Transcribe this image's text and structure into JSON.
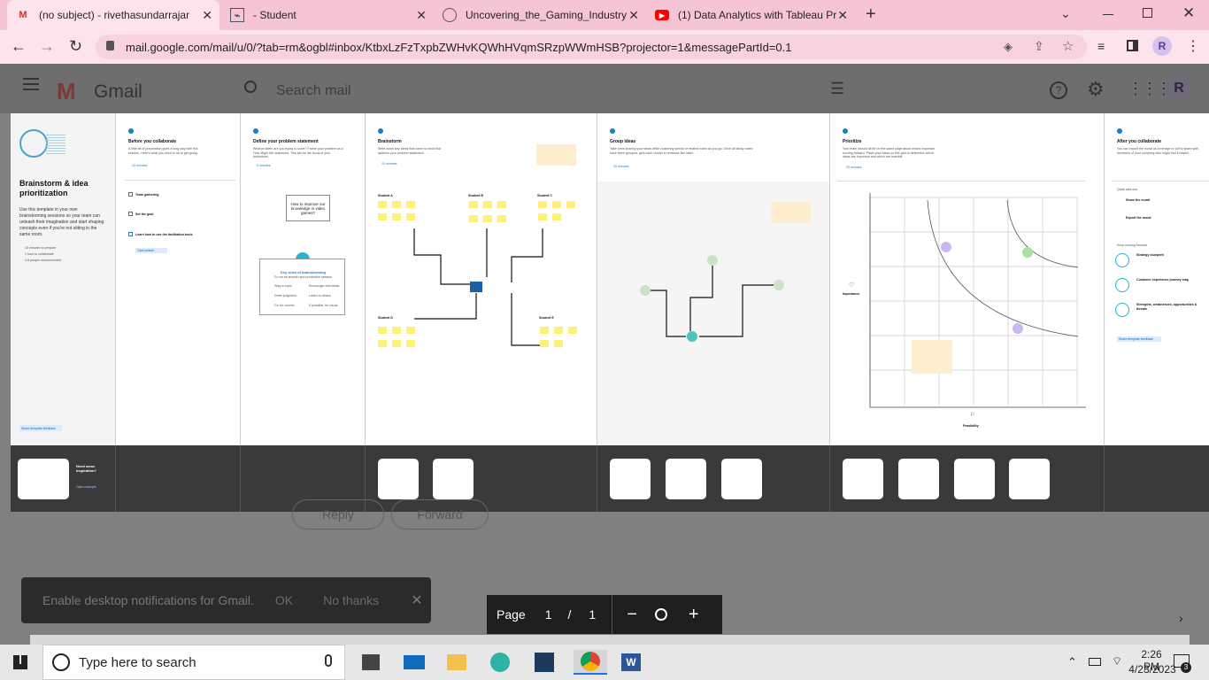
{
  "browser": {
    "tabs": [
      {
        "title": "(no subject) - rivethasundarrajan",
        "icon": "gmail-icon"
      },
      {
        "title": "- Student",
        "icon": "student-icon"
      },
      {
        "title": "Uncovering_the_Gaming_Industry",
        "icon": "globe-icon"
      },
      {
        "title": "(1) Data Analytics with Tableau Pr",
        "icon": "youtube-icon"
      }
    ],
    "new_tab_label": "+",
    "url": "mail.google.com/mail/u/0/?tab=rm&ogbl#inbox/KtbxLzFzTxpbZWHvKQWhHVqmSRzpWWmHSB?projector=1&messagePartId=0.1"
  },
  "gmail": {
    "logo_text": "Gmail",
    "search_placeholder": "Search mail"
  },
  "document": {
    "intro": {
      "title": "Brainstorm & idea prioritization",
      "body": "Use this template in your own brainstorming sessions so your team can unleash their imagination and start shaping concepts even if you're not sitting in the same room.",
      "meta": [
        "10 minutes to prepare",
        "1 hour to collaborate",
        "2-8 people recommended"
      ],
      "feedback": "Share template feedback"
    },
    "steps": [
      {
        "title": "Before you collaborate",
        "desc": "A little bit of preparation goes a long way with this session. Here's what you need to do to get going.",
        "time": "10 minutes",
        "items": [
          "Team gathering",
          "Set the goal",
          "Learn how to use the facilitation tools"
        ],
        "link": "Open article"
      },
      {
        "title": "Define your problem statement",
        "desc": "What problem are you trying to solve? Frame your problem as a How Might We statement. This will be the focus of your brainstorm.",
        "time": "5 minutes",
        "card": "How to improve our knowledge in video games?",
        "rules_title": "Key rules of brainstorming",
        "rules_sub": "To run an smooth and productive session",
        "rules": [
          "Stay in topic.",
          "Encourage wild ideas.",
          "Defer judgment.",
          "Listen to others.",
          "Go for volume.",
          "If possible, be visual."
        ]
      },
      {
        "title": "Brainstorm",
        "desc": "Write down any ideas that come to mind that address your problem statement.",
        "time": "10 minutes",
        "groups": [
          "Student A",
          "Student B",
          "Student C",
          "Student D",
          "Student E"
        ],
        "center": "Problem statement"
      },
      {
        "title": "Group ideas",
        "desc": "Take turns sharing your ideas while clustering similar or related notes as you go. Once all sticky notes have been grouped, give each cluster a sentence-like label.",
        "time": "20 minutes"
      },
      {
        "title": "Prioritize",
        "desc": "Your team should all be on the same page about what's important moving forward. Place your ideas on this grid to determine which ideas are important and which are feasible.",
        "time": "20 minutes",
        "y_label": "Importance",
        "x_label": "Feasibility"
      },
      {
        "title": "After you collaborate",
        "desc": "You can export the mural as an image or pdf to share with members of your company who might find it helpful.",
        "quick_adds": "Quick add-ons",
        "keep_moving": "Keep moving forward",
        "items": [
          "Share the mural",
          "Export the mural",
          "Strategy blueprint",
          "Customer experience journey map",
          "Strengths, weaknesses, opportunities & threats"
        ],
        "feedback": "Share template feedback"
      }
    ],
    "strip_help": {
      "title": "Need some inspiration?",
      "link": "Open example"
    }
  },
  "reply_label": "Reply",
  "forward_label": "Forward",
  "notification": {
    "text": "Enable desktop notifications for Gmail.",
    "ok": "OK",
    "no_thanks": "No thanks"
  },
  "pager": {
    "label": "Page",
    "current": "1",
    "separator": "/",
    "total": "1"
  },
  "taskbar": {
    "search_placeholder": "Type here to search",
    "time": "2:26 PM",
    "date": "4/23/2023",
    "notification_count": "3"
  }
}
